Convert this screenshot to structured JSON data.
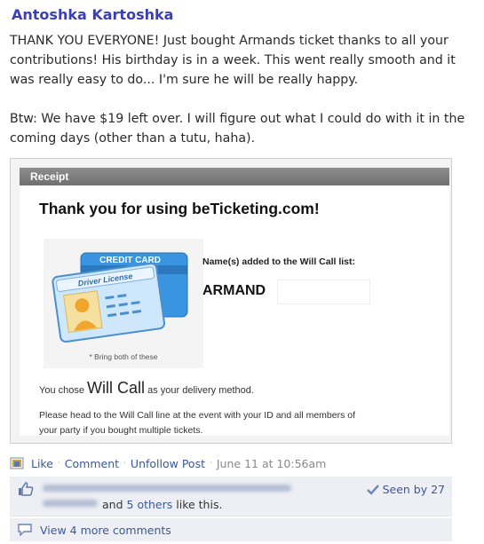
{
  "post": {
    "author": "Antoshka Kartoshka",
    "paragraph1": "THANK YOU EVERYONE! Just bought Armands ticket thanks to all your contributions! His birthday is in a week. This went really smooth and it was really easy to do... I'm sure he will be really happy.",
    "paragraph2": "Btw: We have $19 left over. I will figure out what I could do with it in the coming days (other than a tutu, haha)."
  },
  "receipt": {
    "header": "Receipt",
    "thanks": "Thank you for using beTicketing.com!",
    "card_title": "CREDIT CARD",
    "license_title": "Driver License",
    "card_note": "* Bring both of these",
    "names_label": "Name(s) added to the Will Call list:",
    "names_value": "ARMAND",
    "chose_prefix": "You chose",
    "chose_method": "Will Call",
    "chose_suffix": "as your delivery method.",
    "instructions": "Please head to the Will Call line at the event with your ID and all members of your party if you bought multiple tickets."
  },
  "actions": {
    "like": "Like",
    "comment": "Comment",
    "unfollow": "Unfollow Post",
    "timestamp": "June 11 at 10:56am"
  },
  "likes": {
    "and_text": "and",
    "others_link": "5 others",
    "suffix": "like this.",
    "seen_by": "Seen by 27"
  },
  "comments": {
    "view_more": "View 4 more comments"
  },
  "colors": {
    "link": "#3b5998",
    "author": "#3b3fb6",
    "panel": "#edeff4",
    "card_blue": "#2f86d6"
  }
}
